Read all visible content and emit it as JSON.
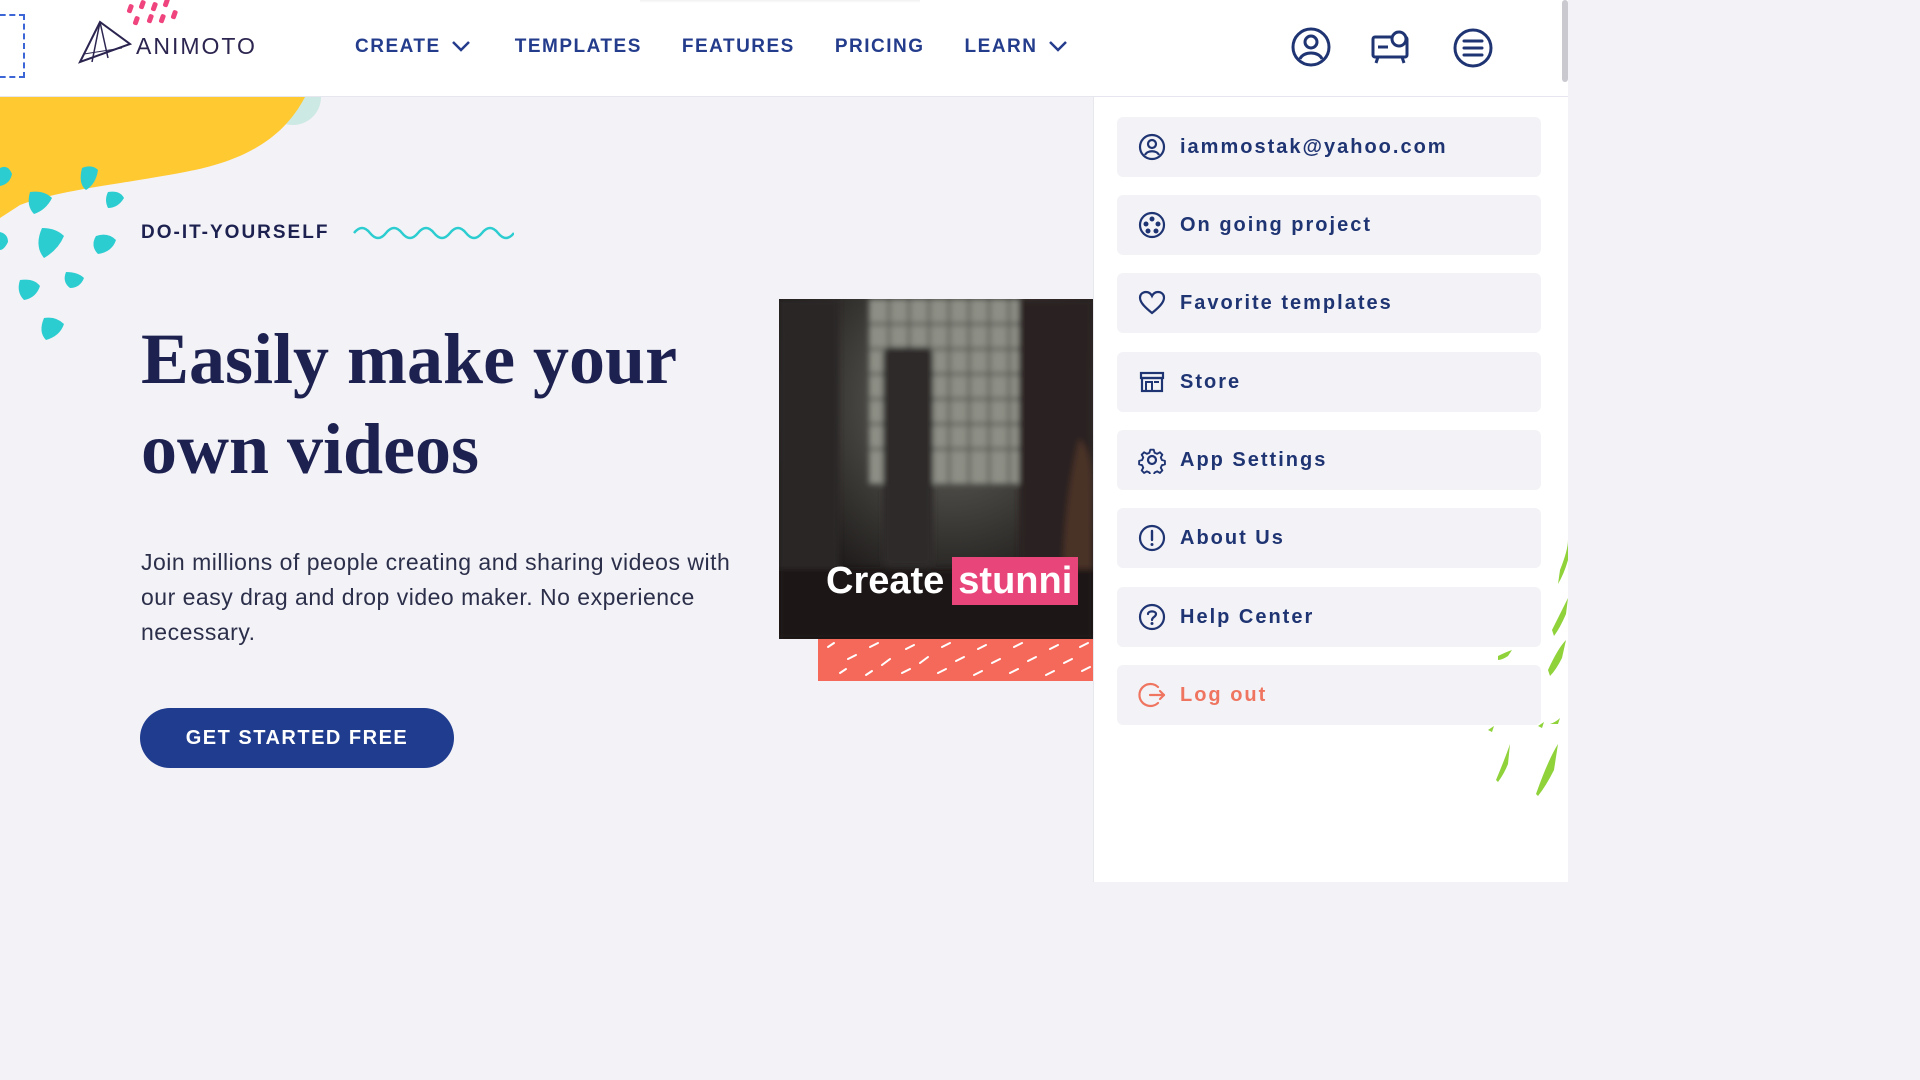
{
  "header": {
    "logo_text": "ANIMOTO",
    "nav": [
      {
        "label": "CREATE",
        "has_dropdown": true
      },
      {
        "label": "TEMPLATES",
        "has_dropdown": false
      },
      {
        "label": "FEATURES",
        "has_dropdown": false
      },
      {
        "label": "PRICING",
        "has_dropdown": false
      },
      {
        "label": "LEARN",
        "has_dropdown": true
      }
    ],
    "icons": [
      "user-circle-icon",
      "projector-icon",
      "menu-circle-icon"
    ]
  },
  "hero": {
    "eyebrow": "DO-IT-YOURSELF",
    "headline_line1": "Easily make your",
    "headline_line2": "own videos",
    "subtext": "Join millions of people creating and sharing videos with our easy drag and drop video maker. No experience necessary.",
    "cta": "GET STARTED FREE",
    "video_caption_a": "Create",
    "video_caption_b": "stunni"
  },
  "menu": {
    "items": [
      {
        "label": "iammostak@yahoo.com",
        "icon": "user-circle-icon"
      },
      {
        "label": "On going project",
        "icon": "film-reel-icon"
      },
      {
        "label": "Favorite templates",
        "icon": "heart-icon"
      },
      {
        "label": "Store",
        "icon": "store-icon"
      },
      {
        "label": "App Settings",
        "icon": "gear-icon"
      },
      {
        "label": "About Us",
        "icon": "info-circle-icon"
      },
      {
        "label": "Help Center",
        "icon": "question-circle-icon"
      },
      {
        "label": "Log out",
        "icon": "logout-icon"
      }
    ]
  },
  "colors": {
    "navy": "#1c2150",
    "nav_blue": "#243c8c",
    "cta_blue": "#1f3c8e",
    "yellow": "#ffc931",
    "teal": "#2ccdd0",
    "pink": "#e8457a",
    "coral": "#f5695a",
    "logout": "#ef7560",
    "green": "#8fd23a"
  }
}
